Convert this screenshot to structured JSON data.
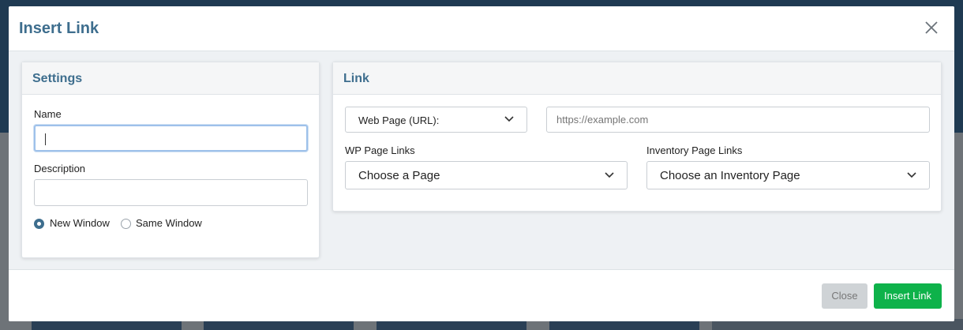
{
  "modal": {
    "title": "Insert Link",
    "close_icon": "close-icon"
  },
  "settings": {
    "heading": "Settings",
    "name_label": "Name",
    "name_value": "",
    "description_label": "Description",
    "description_value": "",
    "radio_new": "New Window",
    "radio_same": "Same Window",
    "selected_target": "New Window"
  },
  "link": {
    "heading": "Link",
    "type_select": "Web Page (URL):",
    "url_placeholder": "https://example.com",
    "wp_label": "WP Page Links",
    "wp_select": "Choose a Page",
    "inv_label": "Inventory Page Links",
    "inv_select": "Choose an Inventory Page"
  },
  "footer": {
    "close_label": "Close",
    "insert_label": "Insert Link"
  },
  "colors": {
    "accent": "#3e6e8e",
    "primary_button": "#0eb24a",
    "focus_ring": "#9ec1ea"
  }
}
